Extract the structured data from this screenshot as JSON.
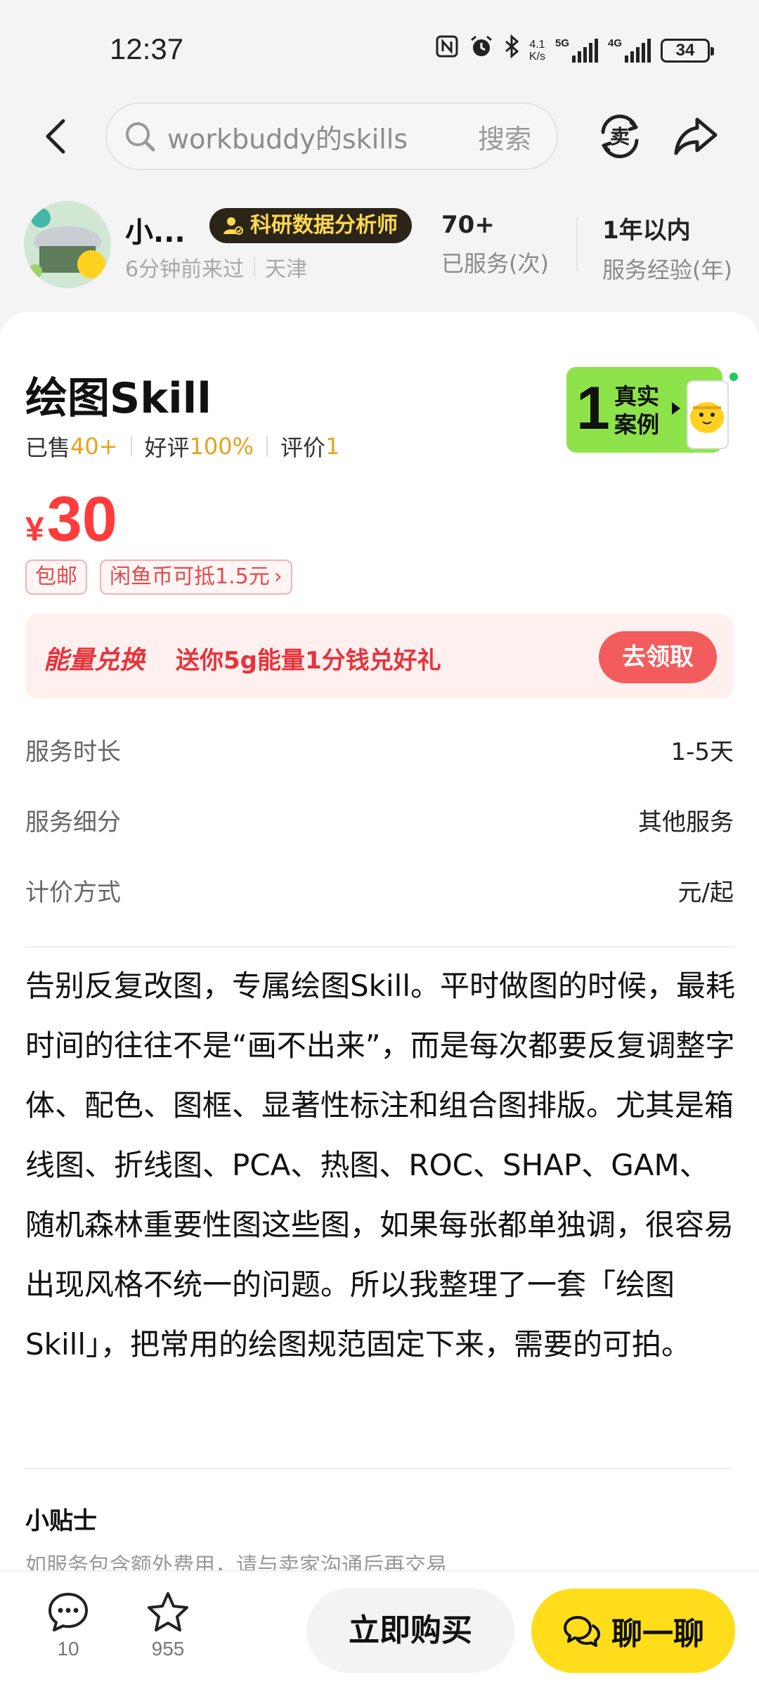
{
  "status_bar": {
    "time": "12:37",
    "net_speed_value": "4.1",
    "net_speed_unit": "K/s",
    "signal_1_label": "5G",
    "signal_2_label": "4G",
    "battery": "34"
  },
  "nav": {
    "search_text": "workbuddy的skills",
    "search_button": "搜索",
    "sell_icon_label": "卖"
  },
  "seller": {
    "name": "小...",
    "badge": "科研数据分析师",
    "last_seen": "6分钟前来过",
    "location": "天津",
    "served_value": "70+",
    "served_label": "已服务(次)",
    "experience_value": "1年以内",
    "experience_label": "服务经验(年)"
  },
  "product": {
    "title": "绘图Skill",
    "sold_label": "已售",
    "sold_value": "40+",
    "rating_label": "好评",
    "rating_value": "100%",
    "reviews_label": "评价",
    "reviews_value": "1",
    "currency": "¥",
    "price": "30",
    "case_count": "1",
    "case_label_1": "真实",
    "case_label_2": "案例",
    "tags": {
      "free_shipping": "包邮",
      "coin": "闲鱼币可抵1.5元"
    }
  },
  "energy": {
    "title": "能量兑换",
    "desc": "送你5g能量1分钱兑好礼",
    "button": "去领取"
  },
  "specs": [
    {
      "label": "服务时长",
      "value": "1-5天"
    },
    {
      "label": "服务细分",
      "value": "其他服务"
    },
    {
      "label": "计价方式",
      "value": "元/起"
    }
  ],
  "description": "告别反复改图，专属绘图Skill。平时做图的时候，最耗时间的往往不是“画不出来”，而是每次都要反复调整字体、配色、图框、显著性标注和组合图排版。尤其是箱线图、折线图、PCA、热图、ROC、SHAP、GAM、随机森林重要性图这些图，如果每张都单独调，很容易出现风格不统一的问题。所以我整理了一套「绘图 Skill」，把常用的绘图规范固定下来，需要的可拍。",
  "tips": {
    "title": "小贴士",
    "text": "如服务包含额外费用，请与卖家沟通后再交易"
  },
  "bottom_bar": {
    "comments_count": "10",
    "favorites_count": "955",
    "buy_label": "立即购买",
    "chat_label": "聊一聊"
  },
  "colors": {
    "price_red": "#ff3b3b",
    "highlight_orange": "#e5a21c",
    "chat_yellow": "#ffdd1a",
    "case_green": "#8fe34a",
    "energy_red": "#e8333b"
  }
}
